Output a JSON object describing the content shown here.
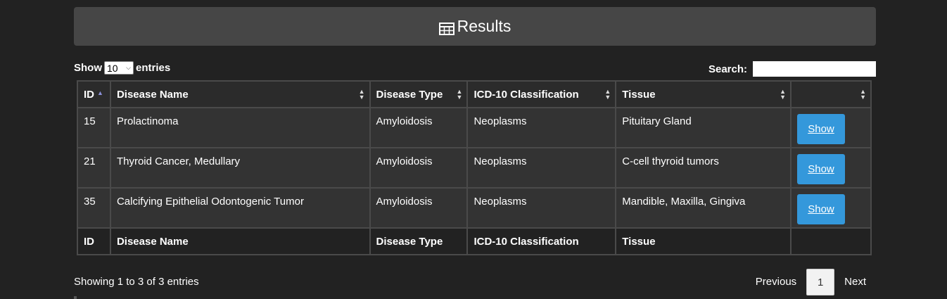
{
  "header": {
    "icon": "table-icon",
    "title": "Results"
  },
  "length": {
    "prefix": "Show",
    "value": "10",
    "suffix": "entries"
  },
  "search": {
    "label": "Search:",
    "value": ""
  },
  "table": {
    "columns": [
      "ID",
      "Disease Name",
      "Disease Type",
      "ICD-10 Classification",
      "Tissue",
      ""
    ],
    "rows": [
      {
        "id": "15",
        "name": "Prolactinoma",
        "type": "Amyloidosis",
        "icd": "Neoplasms",
        "tissue": "Pituitary Gland",
        "action": "Show"
      },
      {
        "id": "21",
        "name": "Thyroid Cancer, Medullary",
        "type": "Amyloidosis",
        "icd": "Neoplasms",
        "tissue": "C-cell thyroid tumors",
        "action": "Show"
      },
      {
        "id": "35",
        "name": "Calcifying Epithelial Odontogenic Tumor",
        "type": "Amyloidosis",
        "icd": "Neoplasms",
        "tissue": "Mandible, Maxilla, Gingiva",
        "action": "Show"
      }
    ],
    "footer_columns": [
      "ID",
      "Disease Name",
      "Disease Type",
      "ICD-10 Classification",
      "Tissue",
      ""
    ]
  },
  "info": "Showing 1 to 3 of 3 entries",
  "pagination": {
    "previous": "Previous",
    "page": "1",
    "next": "Next"
  },
  "colors": {
    "background": "#222222",
    "panel": "#464646",
    "row": "#333333",
    "button": "#3498db"
  }
}
